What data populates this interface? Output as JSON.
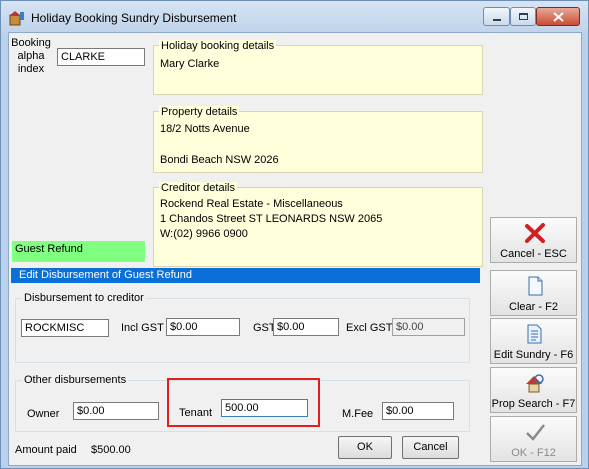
{
  "window": {
    "title": "Holiday Booking Sundry Disbursement"
  },
  "booking": {
    "label": "Booking alpha index",
    "value": "CLARKE"
  },
  "holiday_panel": {
    "title": "Holiday booking details",
    "lines": [
      "Mary Clarke"
    ]
  },
  "property_panel": {
    "title": "Property details",
    "lines": [
      "18/2 Notts Avenue",
      "",
      "Bondi Beach  NSW  2026"
    ]
  },
  "creditor_panel": {
    "title": "Creditor details",
    "lines": [
      "Rockend Real Estate - Miscellaneous",
      "1 Chandos Street ST LEONARDS NSW 2065",
      "W:(02) 9966 0900"
    ]
  },
  "guest_refund_label": "Guest Refund",
  "section_header": "Edit Disbursement of Guest Refund",
  "disbursement_group": {
    "title": "Disbursement to creditor",
    "creditor_code": "ROCKMISC",
    "incl_gst_label": "Incl GST",
    "incl_gst_value": "$0.00",
    "gst_label": "GST",
    "gst_value": "$0.00",
    "excl_gst_label": "Excl GST",
    "excl_gst_value": "$0.00"
  },
  "other_group": {
    "title": "Other disbursements",
    "owner_label": "Owner",
    "owner_value": "$0.00",
    "tenant_label": "Tenant",
    "tenant_value": "500.00",
    "mfee_label": "M.Fee",
    "mfee_value": "$0.00"
  },
  "amount_paid": {
    "label": "Amount paid",
    "value": "$500.00"
  },
  "buttons": {
    "ok": "OK",
    "cancel": "Cancel"
  },
  "side_buttons": [
    {
      "label": "Cancel - ESC",
      "icon": "red-x-icon"
    },
    {
      "label": "Clear - F2",
      "icon": "blank-page-icon"
    },
    {
      "label": "Edit Sundry - F6",
      "icon": "document-icon"
    },
    {
      "label": "Prop Search - F7",
      "icon": "house-search-icon"
    },
    {
      "label": "OK - F12",
      "icon": "checkmark-icon"
    }
  ],
  "colors": {
    "highlight_green": "#80ff80",
    "section_header_blue": "#0a6fd8",
    "tenant_highlight_red": "#e02020",
    "panel_yellow": "#ffffdc"
  }
}
